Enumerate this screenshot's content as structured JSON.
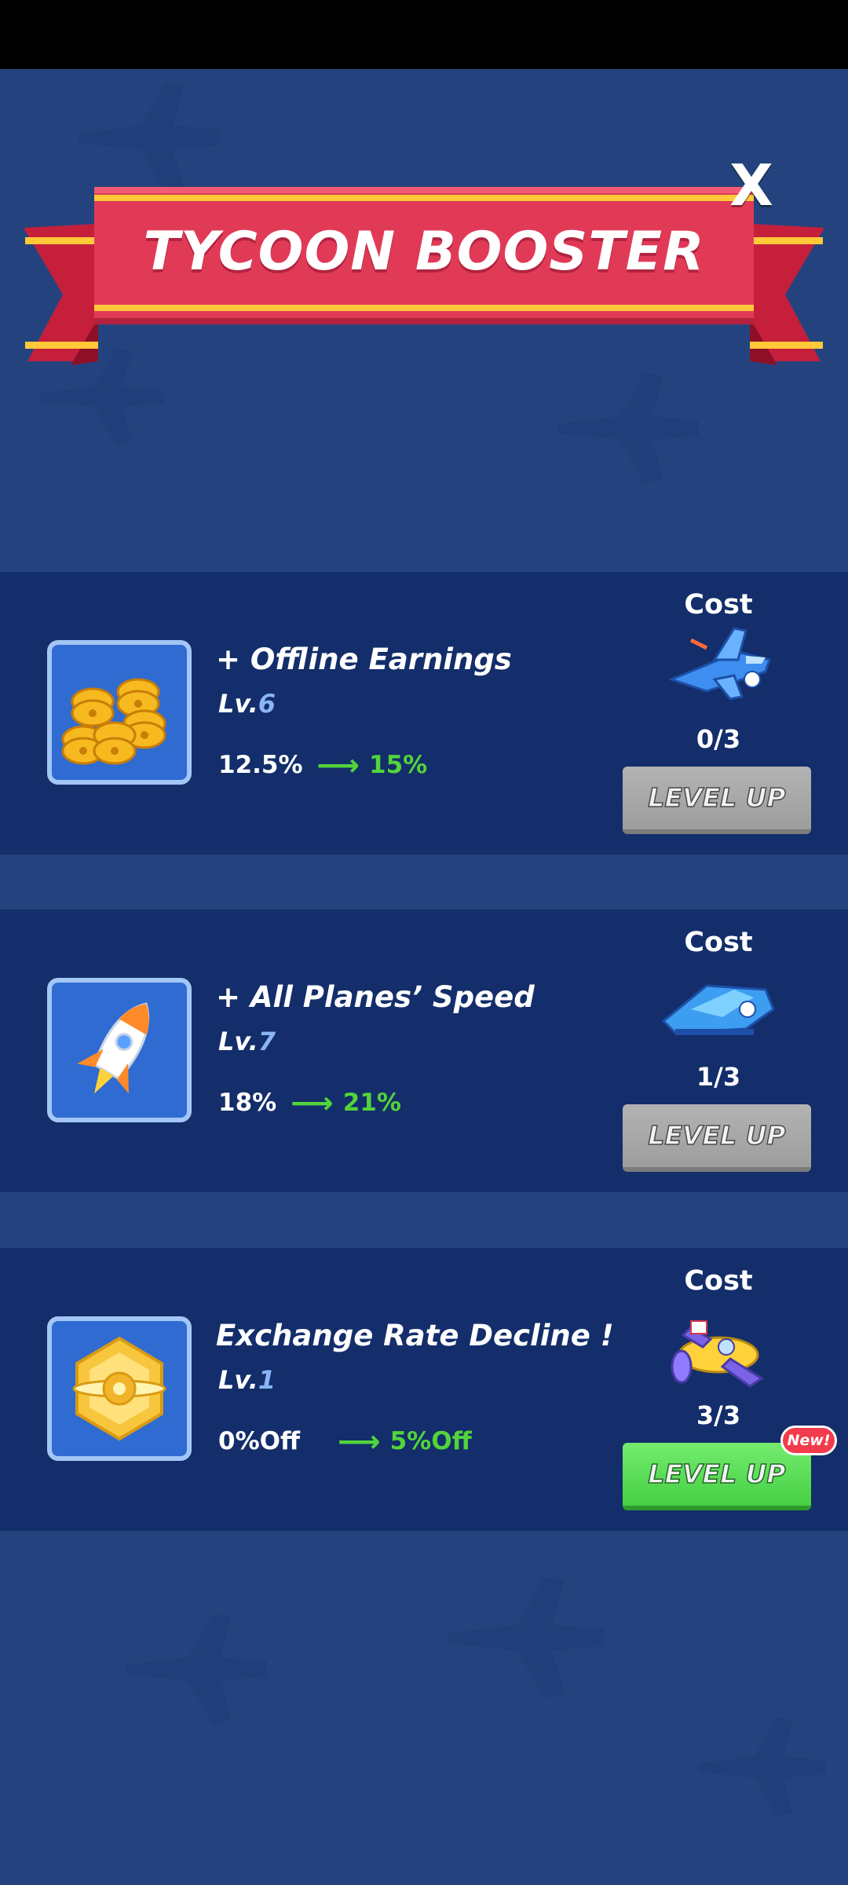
{
  "header": {
    "title": "TYCOON BOOSTER",
    "close_label": "X"
  },
  "colors": {
    "background": "#24437e",
    "row": "#132e6a",
    "ribbon": "#e13a57",
    "ribbon_stripe": "#ffc93a",
    "green": "#52d43a"
  },
  "boosters": [
    {
      "icon": "gold-coins-icon",
      "title": "+ Offline Earnings",
      "level_prefix": "Lv.",
      "level": "6",
      "from": "12.5%",
      "to": "15%",
      "cost_label": "Cost",
      "cost_icon": "blue-jet-plane-icon",
      "cost_count": "0/3",
      "button_label": "LEVEL UP",
      "button_state": "disabled"
    },
    {
      "icon": "rocket-icon",
      "title": "+ All Planes’ Speed",
      "level_prefix": "Lv.",
      "level": "7",
      "from": "18%",
      "to": "21%",
      "cost_label": "Cost",
      "cost_icon": "blue-stealth-plane-icon",
      "cost_count": "1/3",
      "button_label": "LEVEL UP",
      "button_state": "disabled"
    },
    {
      "icon": "gold-propeller-badge-icon",
      "title": "Exchange Rate Decline !",
      "level_prefix": "Lv.",
      "level": "1",
      "from": "0%Off",
      "to": "5%Off",
      "cost_label": "Cost",
      "cost_icon": "yellow-purple-plane-icon",
      "cost_count": "3/3",
      "button_label": "LEVEL UP",
      "button_state": "enabled",
      "badge": "New!"
    }
  ]
}
